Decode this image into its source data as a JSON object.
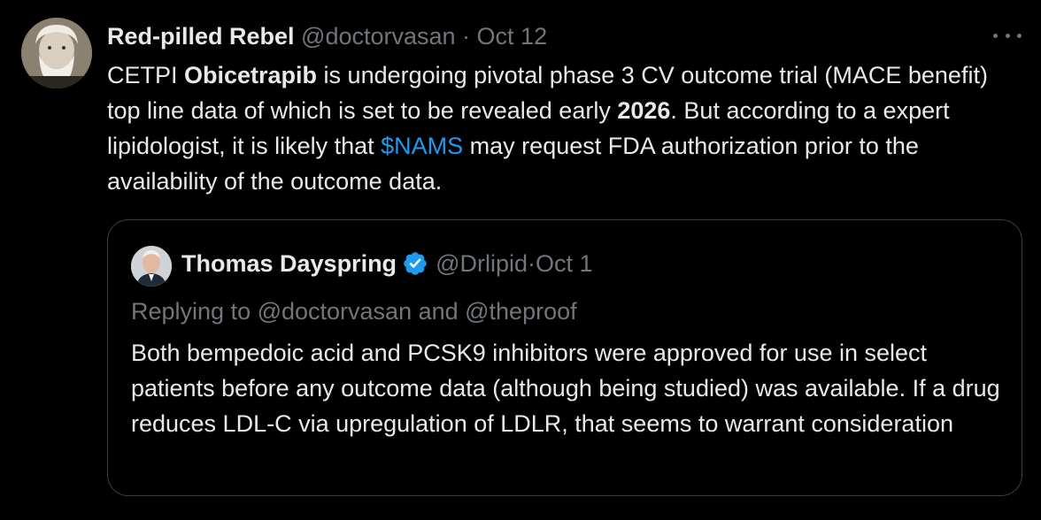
{
  "tweet": {
    "author_name": "Red-pilled Rebel",
    "author_handle": "@doctorvasan",
    "separator": " · ",
    "date": "Oct 12",
    "more_icon": "more-horizontal-icon",
    "body": {
      "part1": "CETPI ",
      "bold1": "Obicetrapib",
      "part2": " is undergoing pivotal phase 3 CV outcome trial (MACE benefit) top line data of which is set to be revealed early ",
      "bold2": "2026",
      "part3": ". But according to a expert lipidologist, it is likely that ",
      "cashtag": "$NAMS",
      "part4": " may request FDA authorization prior to the availability of the outcome data."
    }
  },
  "quote": {
    "author_name": "Thomas Dayspring",
    "verified_icon": "verified-badge-icon",
    "author_handle": "@Drlipid",
    "separator": " · ",
    "date": "Oct 1",
    "replying_to": "Replying to @doctorvasan and @theproof",
    "text": "Both bempedoic acid and PCSK9 inhibitors were approved for use in select patients before any outcome data (although being studied) was available. If a drug reduces LDL-C via upregulation of LDLR, that seems to warrant consideration"
  },
  "colors": {
    "background": "#000000",
    "text": "#e7e9ea",
    "muted": "#71767b",
    "accent": "#1d9bf0",
    "border": "#3a3d40"
  }
}
